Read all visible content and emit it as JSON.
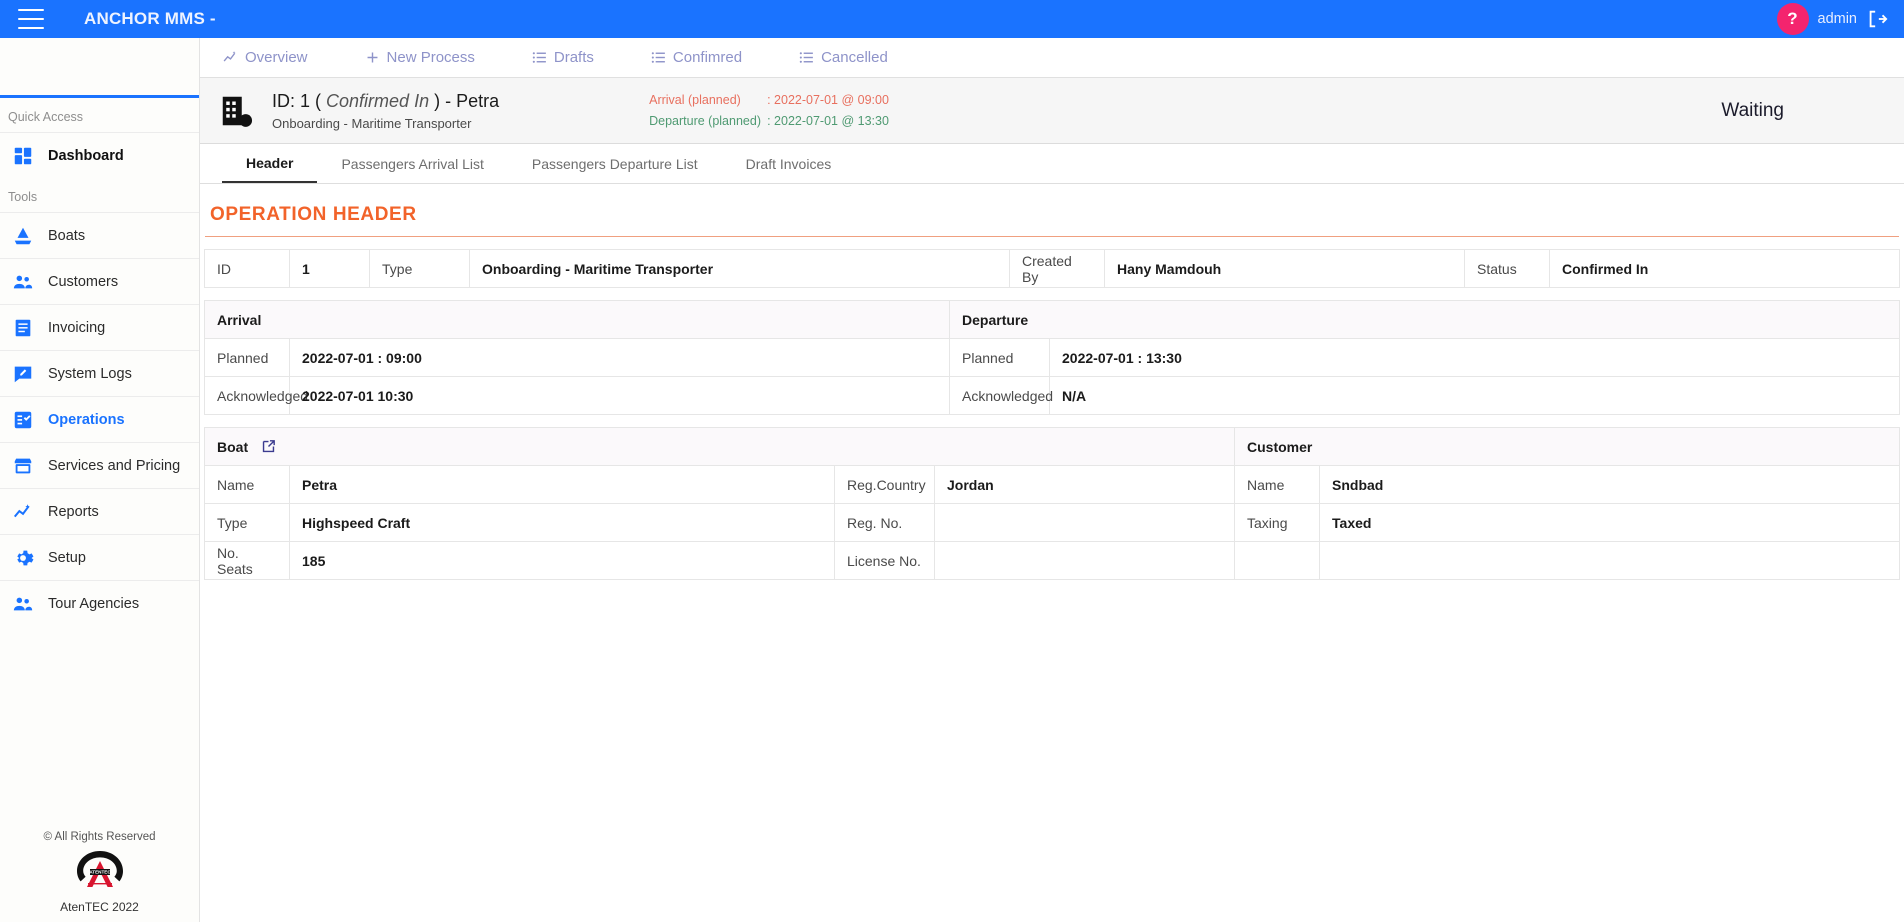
{
  "topbar": {
    "menu_icon": "hamburger-icon",
    "brand": "ANCHOR MMS -",
    "avatar_glyph": "?",
    "admin_label": "admin",
    "logout_icon": "logout-icon",
    "bg_color": "#1a73ff",
    "avatar_color": "#f4246e"
  },
  "sidebar": {
    "quick_access_label": "Quick Access",
    "tools_label": "Tools",
    "quick_items": [
      {
        "label": "Dashboard",
        "icon": "dashboard-icon"
      }
    ],
    "tool_items": [
      {
        "label": "Boats",
        "icon": "boat-icon"
      },
      {
        "label": "Customers",
        "icon": "customers-icon"
      },
      {
        "label": "Invoicing",
        "icon": "invoicing-icon"
      },
      {
        "label": "System Logs",
        "icon": "system-logs-icon"
      },
      {
        "label": "Operations",
        "icon": "operations-icon",
        "active": true
      },
      {
        "label": "Services and Pricing",
        "icon": "services-pricing-icon"
      },
      {
        "label": "Reports",
        "icon": "reports-icon"
      },
      {
        "label": "Setup",
        "icon": "setup-gear-icon"
      },
      {
        "label": "Tour Agencies",
        "icon": "tour-agencies-icon"
      }
    ],
    "footer": {
      "rights": "© All Rights Reserved",
      "logo_text": "ATENTEC",
      "company": "AtenTEC 2022"
    }
  },
  "top_tabs": [
    {
      "label": "Overview",
      "icon": "overview-chart-icon"
    },
    {
      "label": "New Process",
      "icon": "plus-icon"
    },
    {
      "label": "Drafts",
      "icon": "list-icon"
    },
    {
      "label": "Confimred",
      "icon": "list-icon"
    },
    {
      "label": "Cancelled",
      "icon": "list-icon"
    }
  ],
  "operation_banner": {
    "icon": "building-icon",
    "title_prefix": "ID: 1 (",
    "title_status": "Confirmed In",
    "title_suffix": ") - Petra",
    "subtitle": "Onboarding - Maritime Transporter",
    "arrival_label": "Arrival (planned)",
    "arrival_value": ": 2022-07-01 @ 09:00",
    "departure_label": "Departure (planned)",
    "departure_value": ": 2022-07-01 @ 13:30",
    "status_text": "Waiting",
    "arrival_color": "#e8705f",
    "departure_color": "#4f9a72"
  },
  "sub_tabs": [
    {
      "label": "Header",
      "active": true
    },
    {
      "label": "Passengers Arrival List",
      "active": false
    },
    {
      "label": "Passengers Departure List",
      "active": false
    },
    {
      "label": "Draft Invoices",
      "active": false
    }
  ],
  "operation_header": {
    "title": "OPERATION HEADER",
    "title_color": "#f2632a",
    "fields": {
      "id_label": "ID",
      "id_value": "1",
      "type_label": "Type",
      "type_value": "Onboarding - Maritime Transporter",
      "created_by_label": "Created By",
      "created_by_value": "Hany Mamdouh",
      "status_label": "Status",
      "status_value": "Confirmed In"
    }
  },
  "schedule_table": {
    "arrival_head": "Arrival",
    "departure_head": "Departure",
    "rows": [
      {
        "label": "Planned",
        "arrival_value": "2022-07-01 : 09:00",
        "dep_label": "Planned",
        "departure_value": "2022-07-01 : 13:30"
      },
      {
        "label": "Acknowledged",
        "arrival_value": "2022-07-01 10:30",
        "dep_label": "Acknowledged",
        "departure_value": "N/A"
      }
    ]
  },
  "boat_customer": {
    "boat_head": "Boat",
    "boat_link_icon": "external-link-icon",
    "customer_head": "Customer",
    "rows": [
      {
        "boat_label": "Name",
        "boat_value": "Petra",
        "boat_label2": "Reg.Country",
        "boat_value2": "Jordan",
        "cust_label": "Name",
        "cust_value": "Sndbad"
      },
      {
        "boat_label": "Type",
        "boat_value": "Highspeed Craft",
        "boat_label2": "Reg. No.",
        "boat_value2": "",
        "cust_label": "Taxing",
        "cust_value": "Taxed"
      },
      {
        "boat_label": "No. Seats",
        "boat_value": "185",
        "boat_label2": "License No.",
        "boat_value2": "",
        "cust_label": "",
        "cust_value": ""
      }
    ]
  }
}
